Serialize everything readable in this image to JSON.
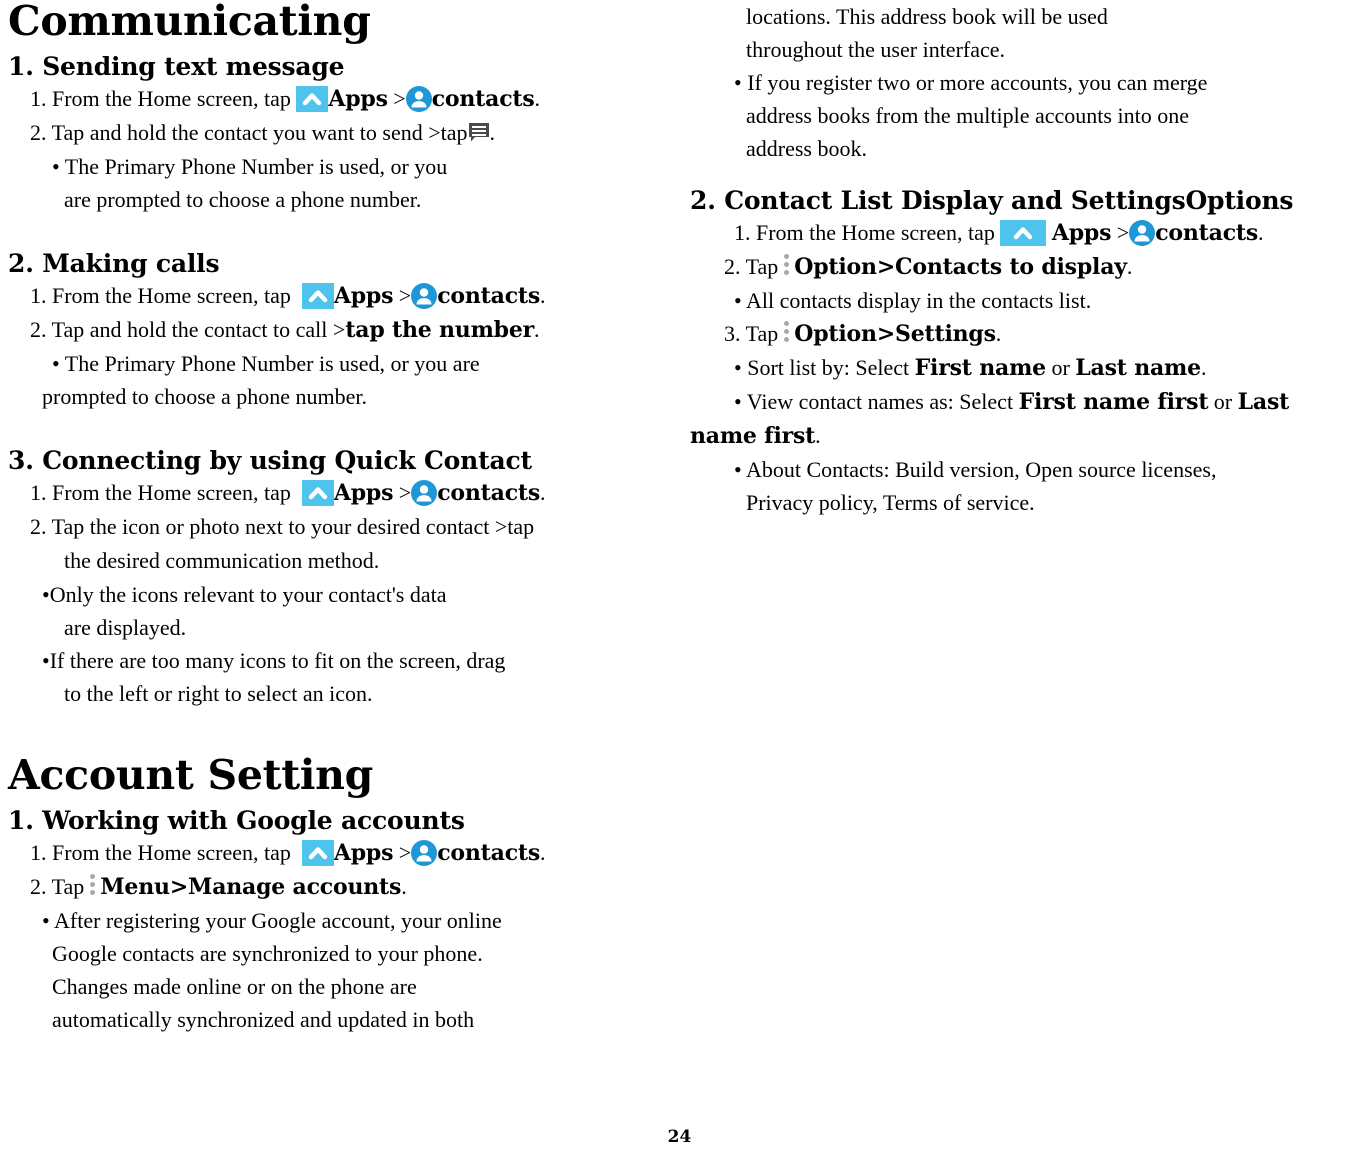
{
  "page": {
    "number": "24",
    "colors": {
      "apps_icon_bg": "#4EC3EE",
      "apps_icon_glyph": "#ffffff",
      "contacts_icon_bg": "#1E97D6",
      "contacts_icon_glyph": "#ffffff",
      "message_icon_bg": "#4a4a4a",
      "menu_icon_dots": "#a8a8a8",
      "text": "#000000",
      "background": "#ffffff"
    },
    "icons": {
      "apps": "apps-chevron-up-icon",
      "contacts": "contacts-person-icon",
      "message": "message-bubble-icon",
      "menu": "overflow-menu-icon"
    }
  },
  "left_column": {
    "title": "Communicating",
    "section1": {
      "heading": "1. Sending text message",
      "step1": {
        "prefix": "1. From the Home screen, tap ",
        "apps_label": "Apps",
        "separator": " >",
        "contacts_label": "contacts",
        "suffix": "."
      },
      "step2": {
        "prefix": "2. Tap and hold the contact you want to send >tap",
        "suffix": "."
      },
      "bullets": [
        "• The Primary Phone Number is used, or you",
        "are prompted to choose a phone number."
      ]
    },
    "section2": {
      "heading": "2. Making calls",
      "step1": {
        "prefix": "1. From the Home screen, tap ",
        "apps_label": "Apps",
        "separator": " >",
        "contacts_label": "contacts",
        "suffix": "."
      },
      "step2": {
        "prefix": "2. Tap and hold the contact to call >",
        "bold": "tap the number",
        "suffix": "."
      },
      "bullets": [
        "• The Primary Phone Number is used, or you are",
        "prompted to choose a phone number."
      ]
    },
    "section3": {
      "heading": "3. Connecting by using Quick Contact",
      "step1": {
        "prefix": "1. From the Home screen, tap ",
        "apps_label": "Apps",
        "separator": " >",
        "contacts_label": "contacts",
        "suffix": "."
      },
      "step2_line1": "2. Tap the icon or photo next to your desired contact >tap",
      "step2_line2": "the desired communication method.",
      "bullets": [
        "•Only the icons relevant to your contact's data",
        "are displayed.",
        "•If there are too many icons to fit on the screen, drag",
        "to the left or right to select an icon."
      ]
    },
    "title2": "Account Setting",
    "section4": {
      "heading": "1. Working with Google accounts",
      "step1": {
        "prefix": "1. From the Home screen, tap ",
        "apps_label": "Apps",
        "separator": " >",
        "contacts_label": "contacts",
        "suffix": "."
      },
      "step2": {
        "prefix": "2. Tap",
        "bold": "Menu>Manage accounts",
        "suffix": "."
      },
      "bullets": [
        "• After registering your Google account, your online",
        "Google contacts are synchronized to your phone.",
        "Changes made online or on the phone are",
        "automatically synchronized and updated in both"
      ]
    }
  },
  "right_column": {
    "continued": [
      "locations. This address book will be used",
      "throughout the user interface."
    ],
    "bullets_top": [
      "• If you register two or more accounts, you can merge",
      "address books from the multiple accounts into one",
      "address book."
    ],
    "section1": {
      "heading": "2. Contact List Display and SettingsOptions",
      "step1": {
        "prefix": "1. From the Home screen, tap  ",
        "apps_label": "Apps",
        "separator": " >",
        "contacts_label": "contacts",
        "suffix": "."
      },
      "step2": {
        "prefix": "2. Tap",
        "bold": "Option>Contacts to display",
        "suffix": "."
      },
      "bullet_after_step2": "• All contacts display in the contacts list.",
      "step3": {
        "prefix": "3. Tap",
        "bold": "Option>Settings",
        "suffix": "."
      },
      "settings_bullets": [
        {
          "pre": "• Sort list by: Select ",
          "b1": "First name",
          "mid": " or ",
          "b2": "Last name",
          "post": "."
        },
        {
          "pre": "• View contact names as: Select ",
          "b1": "First name first",
          "mid": " or ",
          "b2": "Last",
          "post": ""
        }
      ],
      "settings_bullet2_wrap": {
        "bold": "name first",
        "post": "."
      },
      "about_bullets": [
        "• About Contacts: Build version, Open source licenses,",
        "Privacy policy, Terms of service."
      ]
    }
  }
}
